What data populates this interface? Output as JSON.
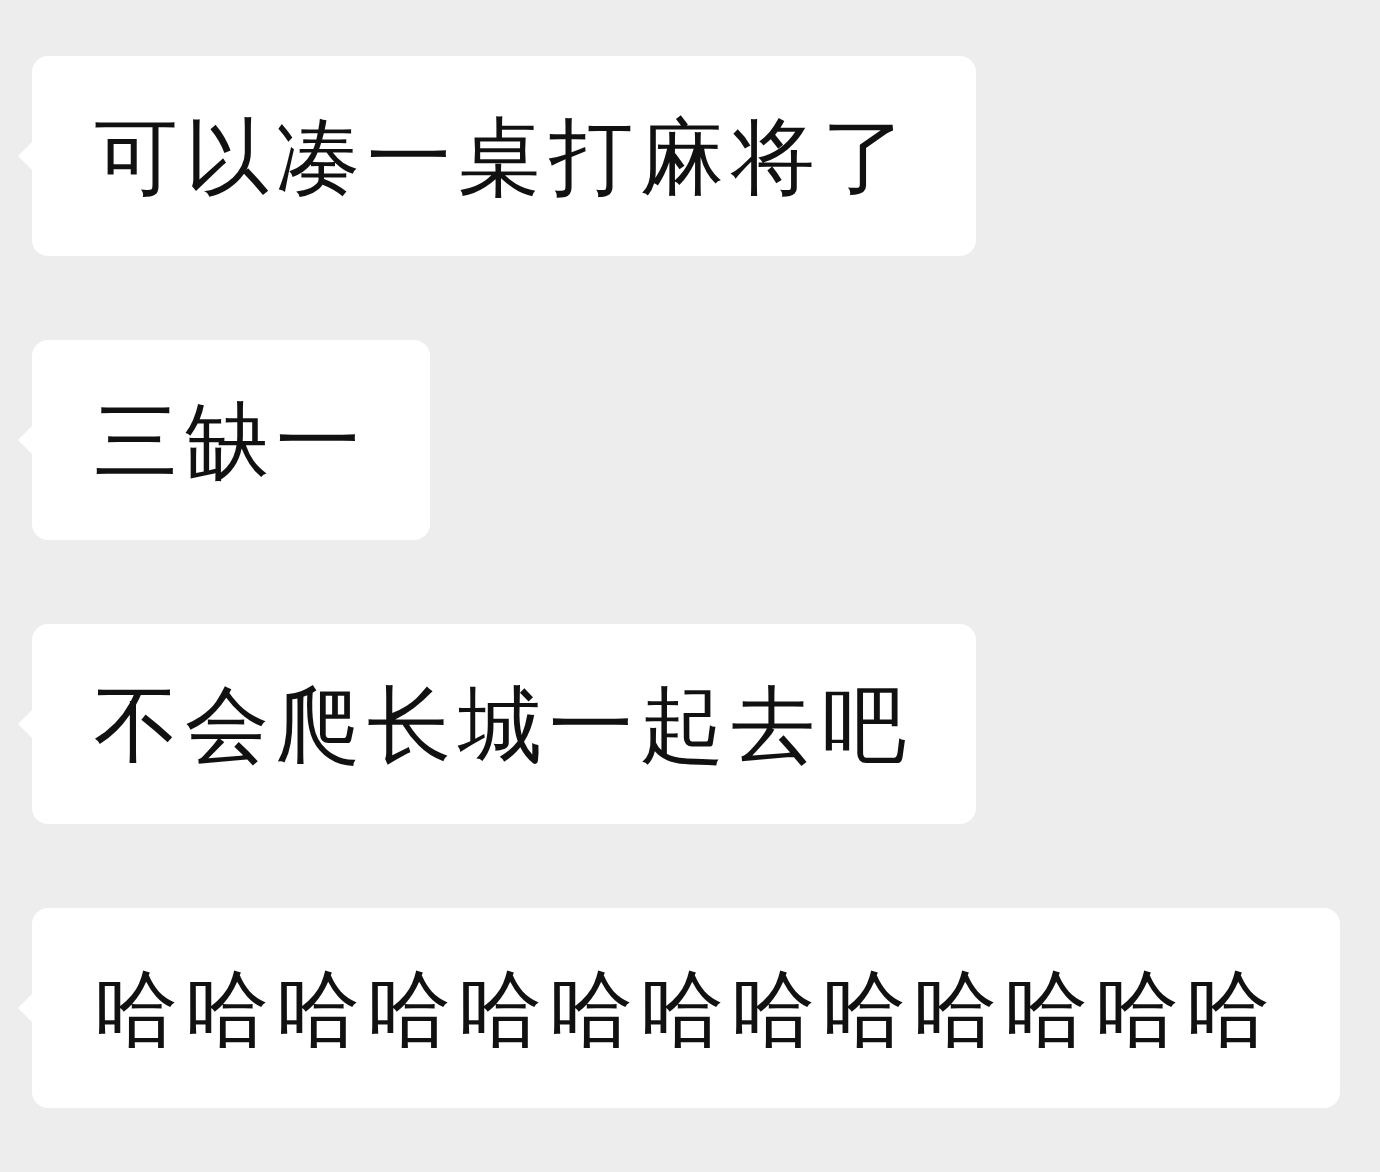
{
  "messages": [
    {
      "text": "可以凑一桌打麻将了"
    },
    {
      "text": "三缺一"
    },
    {
      "text": "不会爬长城一起去吧"
    },
    {
      "text": "哈哈哈哈哈哈哈哈哈哈哈哈哈"
    }
  ]
}
